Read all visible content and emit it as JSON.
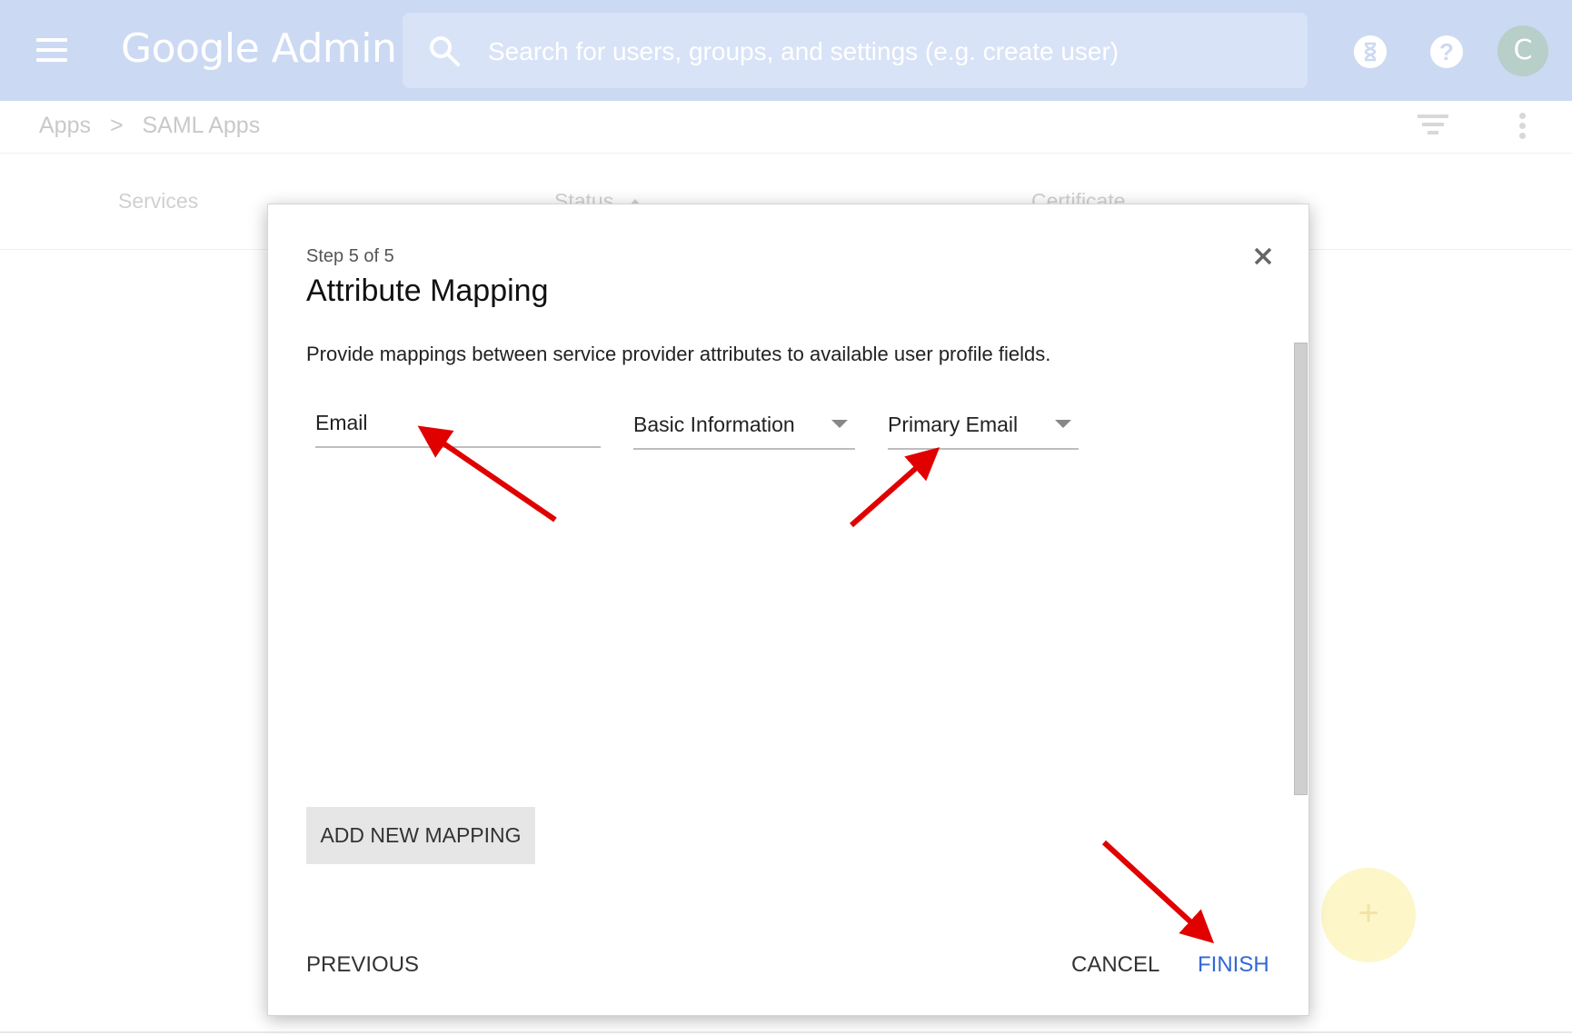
{
  "topbar": {
    "logo": "Google Admin",
    "search_placeholder": "Search for users, groups, and settings (e.g. create user)",
    "avatar_letter": "C"
  },
  "breadcrumb": {
    "apps": "Apps",
    "separator": ">",
    "current": "SAML Apps"
  },
  "table_headers": [
    "Services",
    "Status",
    "Certificate"
  ],
  "dialog": {
    "step": "Step 5 of 5",
    "title": "Attribute Mapping",
    "description": "Provide mappings between service provider attributes to available user profile fields.",
    "mapping": {
      "attribute": "Email",
      "category": "Basic Information",
      "field": "Primary Email"
    },
    "add_button": "ADD NEW MAPPING",
    "previous_button": "PREVIOUS",
    "cancel_button": "CANCEL",
    "finish_button": "FINISH"
  },
  "colors": {
    "topbar": "#ccd9f3",
    "finish": "#3367d6",
    "annotation_arrow": "#e00000",
    "fab": "#fdf6c8"
  },
  "icons": [
    "menu-icon",
    "search-icon",
    "hourglass-icon",
    "help-icon",
    "filter-icon",
    "more-vert-icon",
    "sort-up-icon",
    "close-icon",
    "dropdown-caret-icon",
    "add-icon"
  ]
}
